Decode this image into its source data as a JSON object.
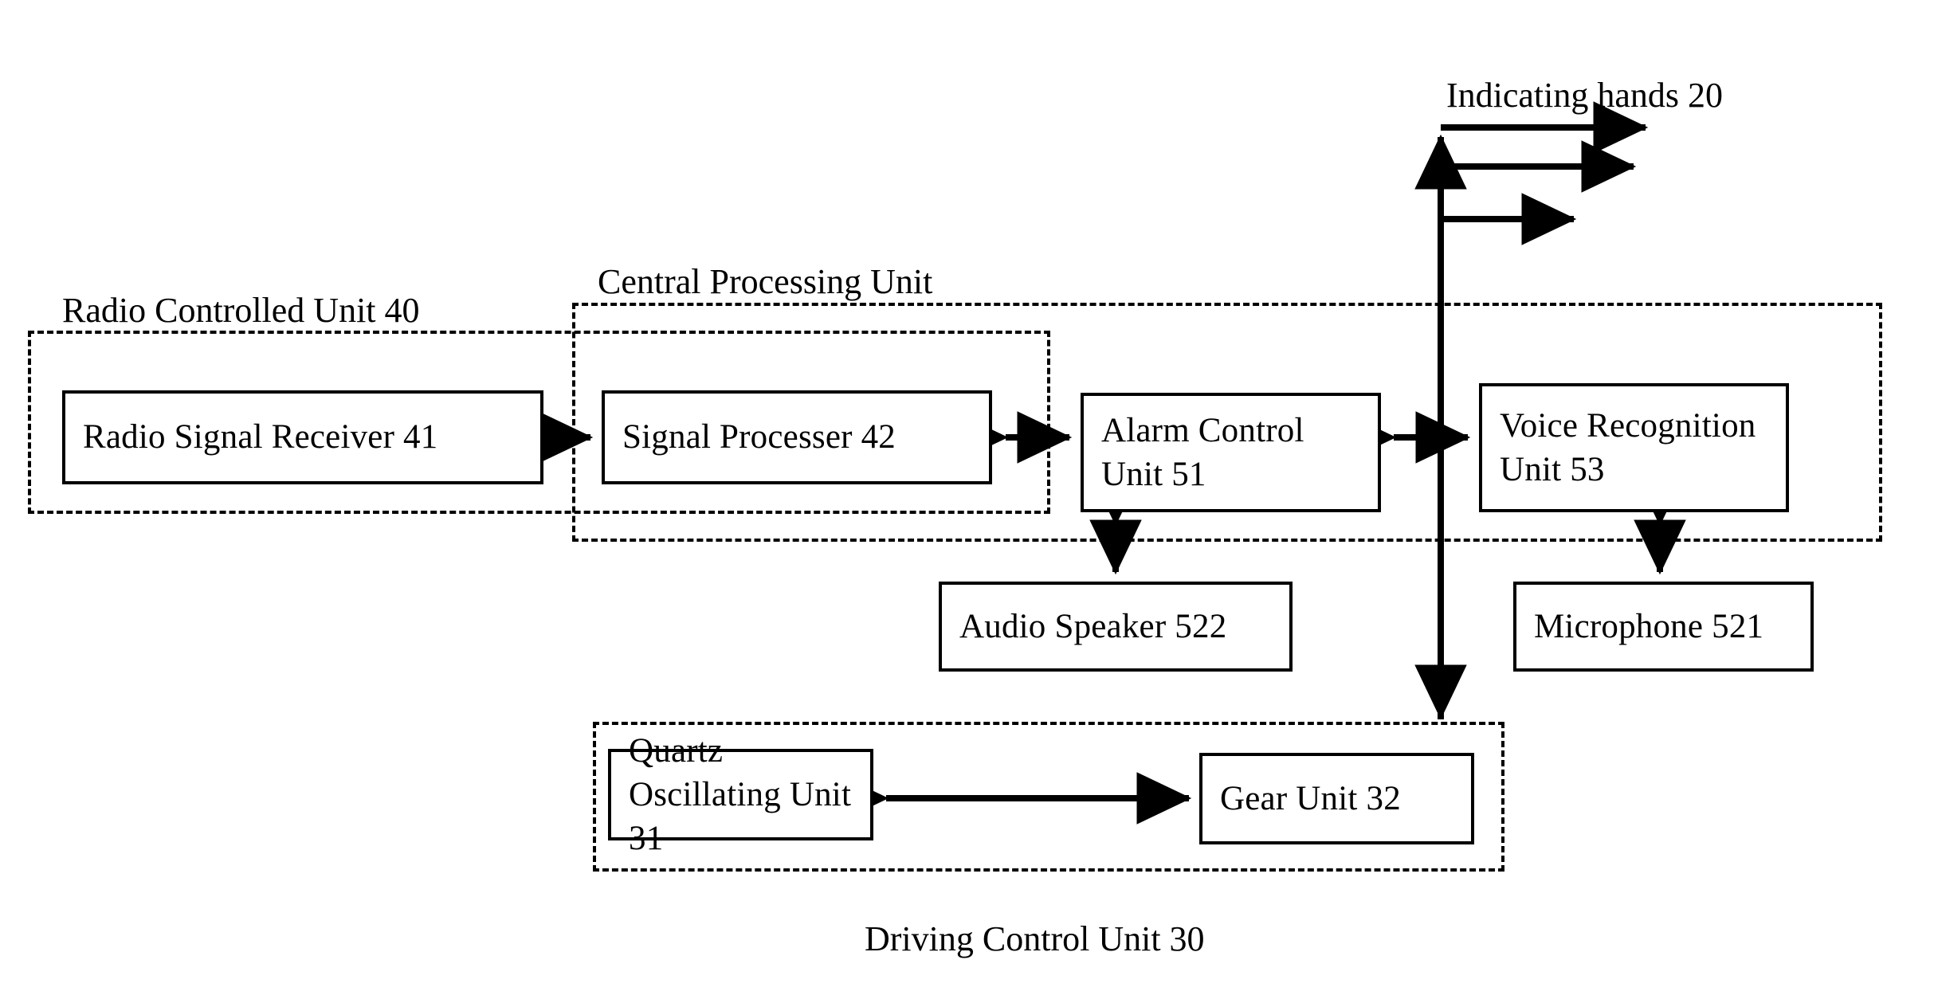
{
  "diagram": {
    "title_caption_top": "Indicating hands 20",
    "bottom_caption": "Driving Control Unit 30",
    "groups": [
      {
        "id": "radio-controlled-unit",
        "label": "Radio Controlled Unit 40"
      },
      {
        "id": "central-processing-unit",
        "label": "Central Processing Unit"
      },
      {
        "id": "driving-control-unit",
        "label": "Driving Control Unit 30"
      }
    ],
    "boxes": [
      {
        "id": "radio-signal-receiver",
        "label": "Radio Signal Receiver 41"
      },
      {
        "id": "signal-processer",
        "label": "Signal Processer 42"
      },
      {
        "id": "alarm-control-unit",
        "label": "Alarm Control\nUnit 51"
      },
      {
        "id": "voice-recognition-unit",
        "label": "Voice Recognition\nUnit 53"
      },
      {
        "id": "audio-speaker",
        "label": "Audio Speaker 522"
      },
      {
        "id": "microphone",
        "label": "Microphone 521"
      },
      {
        "id": "quartz-oscillating-unit",
        "label": "Quartz Oscillating Unit 31"
      },
      {
        "id": "gear-unit",
        "label": "Gear Unit 32"
      }
    ],
    "connectors": [
      {
        "id": "receiver-to-processer",
        "kind": "double-arrow-horizontal"
      },
      {
        "id": "processer-to-alarm",
        "kind": "double-arrow-horizontal"
      },
      {
        "id": "alarm-to-voice",
        "kind": "double-arrow-horizontal"
      },
      {
        "id": "alarm-to-speaker",
        "kind": "double-arrow-vertical"
      },
      {
        "id": "voice-to-microphone",
        "kind": "double-arrow-vertical"
      },
      {
        "id": "quartz-to-gear",
        "kind": "double-arrow-horizontal"
      },
      {
        "id": "driving-to-indicating-hands",
        "kind": "vertical-bus"
      },
      {
        "id": "indicating-hand-branch-1",
        "kind": "single-arrow-right"
      },
      {
        "id": "indicating-hand-branch-2",
        "kind": "single-arrow-right"
      },
      {
        "id": "indicating-hand-branch-3",
        "kind": "single-arrow-right"
      }
    ],
    "colors": {
      "stroke": "#000000",
      "background": "#ffffff"
    }
  }
}
